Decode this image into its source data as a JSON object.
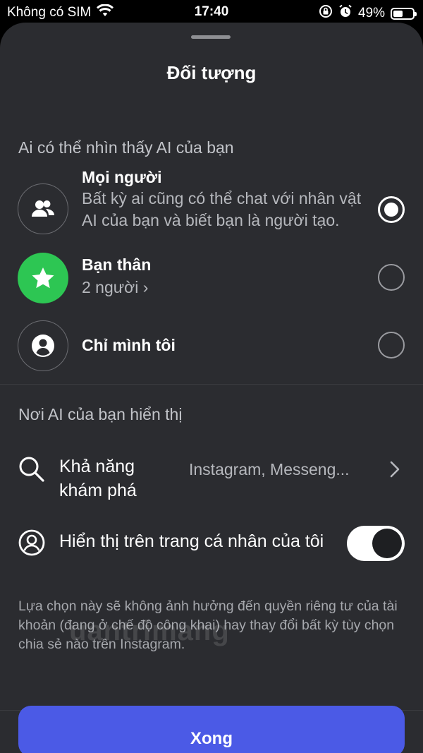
{
  "status_bar": {
    "carrier": "Không có SIM",
    "time": "17:40",
    "battery_text": "49%",
    "battery_level": 0.49
  },
  "sheet": {
    "title": "Đối tượng"
  },
  "audience": {
    "section_title": "Ai có thể nhìn thấy AI của bạn",
    "options": [
      {
        "title": "Mọi người",
        "desc": "Bất kỳ ai cũng có thể chat với nhân vật AI của bạn và biết bạn là người tạo.",
        "selected": true,
        "icon": "people-icon"
      },
      {
        "title": "Bạn thân",
        "desc": "2 người ›",
        "selected": false,
        "icon": "star-icon"
      },
      {
        "title": "Chỉ mình tôi",
        "selected": false,
        "icon": "person-icon"
      }
    ]
  },
  "visibility": {
    "section_title": "Nơi AI của bạn hiển thị",
    "discovery": {
      "label": "Khả năng khám phá",
      "value": "Instagram, Messeng...",
      "icon": "search-icon"
    },
    "profile": {
      "label": "Hiển thị trên trang cá nhân của tôi",
      "icon": "profile-icon",
      "enabled": true
    },
    "note": "Lựa chọn này sẽ không ảnh hưởng đến quyền riêng tư của tài khoản (đang ở chế độ công khai) hay thay đổi bất kỳ tùy chọn chia sẻ nào trên Instagram."
  },
  "watermark": "uantrimang",
  "done_label": "Xong",
  "colors": {
    "sheet_bg": "#2b2c30",
    "accent": "#4b5ae6",
    "close_friends": "#2dc653"
  }
}
